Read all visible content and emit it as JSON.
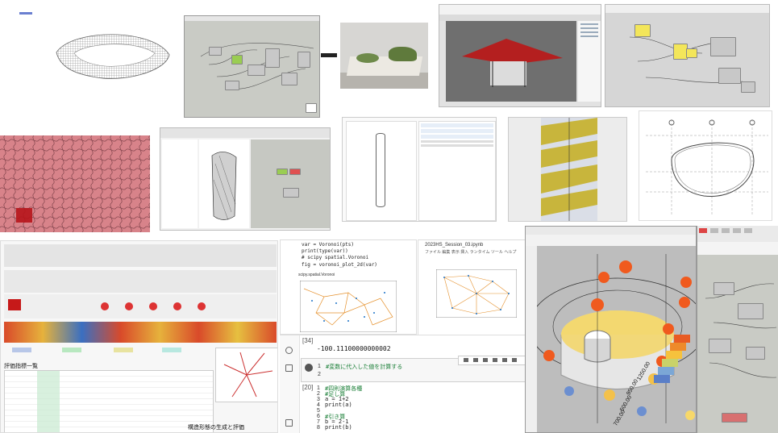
{
  "colors": {
    "panel_gray": "#d7d7d7",
    "grasshopper_canvas": "#c9cbc5",
    "pattern_red": "#d8838a",
    "viewport_dark": "#6f6f6f",
    "spiral_yellow": "#c8b53c",
    "notebook_blue": "#1e73c8",
    "sphere_orange": "#f05a1e"
  },
  "notebook": {
    "output_title": "scipy.spatial.Voronoi",
    "cell_34_prompt": "[34]",
    "cell_34_output": "-100.11100000000002",
    "cell_comment": "#変数に代入した値を計算する",
    "cell_empty_prompt": "2",
    "cell_20_prompt": "[20]",
    "code_lines": [
      {
        "no": "1",
        "text": "#四則演算各種"
      },
      {
        "no": "2",
        "text": "#足し算"
      },
      {
        "no": "3",
        "text": "a = 1+2"
      },
      {
        "no": "4",
        "text": "print(a)"
      },
      {
        "no": "5",
        "text": ""
      },
      {
        "no": "6",
        "text": "#引き算"
      },
      {
        "no": "7",
        "text": "b = 2-1"
      },
      {
        "no": "8",
        "text": "print(b)"
      }
    ],
    "top_code": [
      "var = Voronoi(pts)",
      "print(type(var))",
      "# scipy spatial.Voronoi",
      "fig = voronoi_plot_2d(var)"
    ],
    "file_name": "2023HS_Session_03.ipynb",
    "menu": [
      "ファイル",
      "編集",
      "表示",
      "挿入",
      "ランタイム",
      "ツール",
      "ヘルプ"
    ]
  },
  "viewport_dims": [
    "1250.00",
    "950.00",
    "500.00",
    "700.00"
  ],
  "report": {
    "heading": "評価指標一覧",
    "caption": "構造形態の生成と評価"
  }
}
